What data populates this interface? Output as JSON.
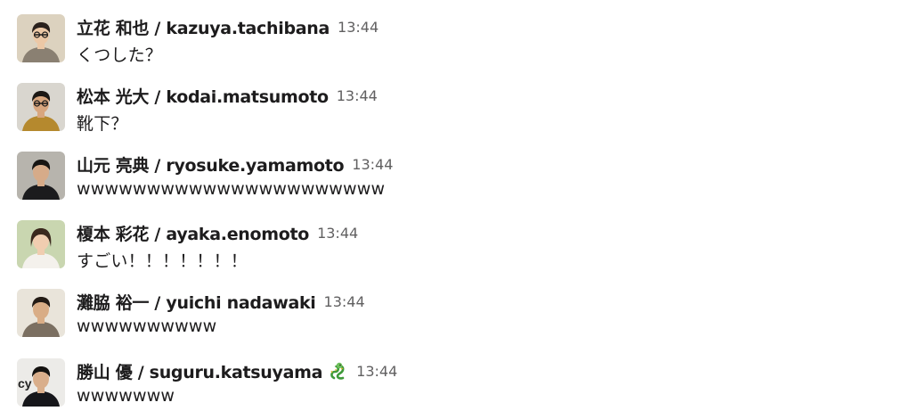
{
  "messages": [
    {
      "display_name": "立花 和也 / kazuya.tachibana",
      "time": "13:44",
      "text": "くつした？",
      "avatar_icon": "user-avatar-icon",
      "colors": {
        "bg": "#dcd2bf",
        "skin": "#ecc8a6",
        "hair": "#2a211c",
        "clothes": "#8a8072"
      }
    },
    {
      "display_name": "松本 光大 / kodai.matsumoto",
      "time": "13:44",
      "text": "靴下？",
      "avatar_icon": "user-avatar-icon",
      "colors": {
        "bg": "#d9d6cf",
        "skin": "#d8a67e",
        "hair": "#1c1814",
        "clothes": "#b5892e"
      }
    },
    {
      "display_name": "山元 亮典 / ryosuke.yamamoto",
      "time": "13:44",
      "text": "wwwwwwwwwwwwwwwwwwwwww",
      "avatar_icon": "user-avatar-icon",
      "colors": {
        "bg": "#b7b4ad",
        "skin": "#d6ab89",
        "hair": "#171513",
        "clothes": "#1b1b1d"
      }
    },
    {
      "display_name": "榎本 彩花 / ayaka.enomoto",
      "time": "13:44",
      "text": "すごい！！！！！！！",
      "avatar_icon": "user-avatar-icon",
      "colors": {
        "bg": "#c9d6b0",
        "skin": "#f0cdb0",
        "hair": "#3a281d",
        "clothes": "#f4f1ec"
      }
    },
    {
      "display_name": "灘脇 裕一 / yuichi nadawaki",
      "time": "13:44",
      "text": "wwwwwwwwww",
      "avatar_icon": "user-avatar-icon",
      "colors": {
        "bg": "#e9e4da",
        "skin": "#d9ad86",
        "hair": "#231b15",
        "clothes": "#7b6f61"
      }
    },
    {
      "display_name": "勝山 優 / suguru.katsuyama",
      "time": "13:44",
      "text": "wwwwwww",
      "avatar_icon": "user-avatar-icon",
      "status_emoji": "dragon-emoji-icon",
      "avatar_label": "cy",
      "colors": {
        "bg": "#ecebe8",
        "skin": "#d9ae8b",
        "hair": "#141210",
        "clothes": "#16161a"
      }
    }
  ]
}
